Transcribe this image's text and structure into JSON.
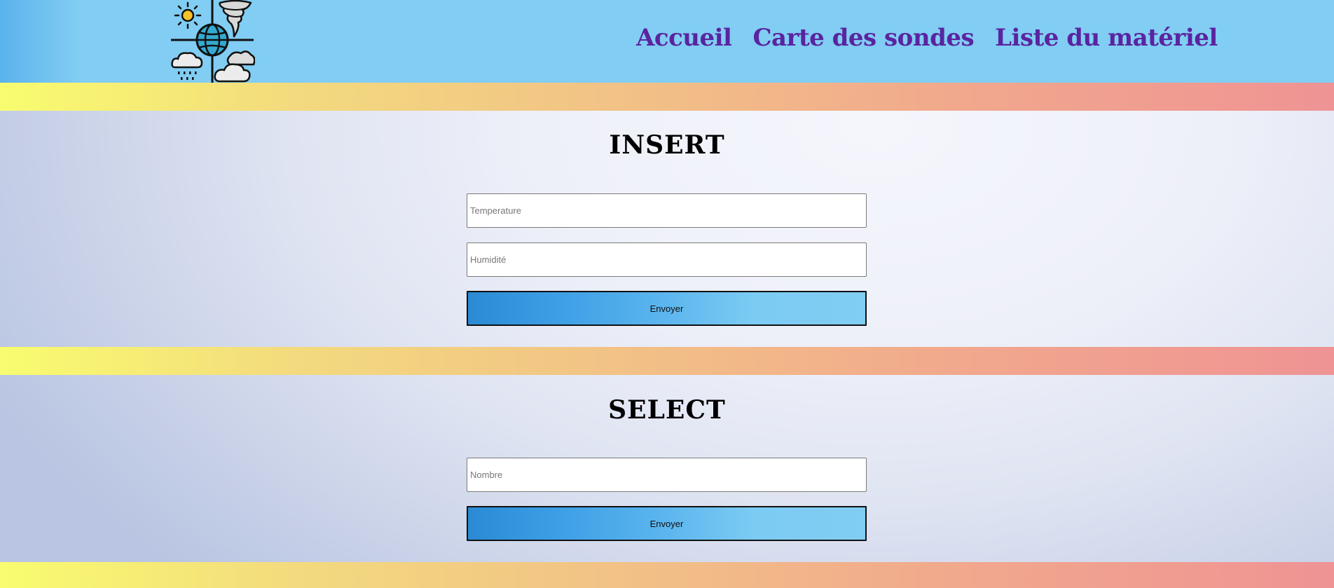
{
  "header": {
    "logo_icon": "weather-logo-icon",
    "nav": [
      {
        "label": "Accueil"
      },
      {
        "label": "Carte des sondes"
      },
      {
        "label": "Liste du matériel"
      }
    ],
    "nav_color": "#5a24a0",
    "background": "#81cdf3"
  },
  "insert": {
    "title": "INSERT",
    "temperature_placeholder": "Temperature",
    "humidity_placeholder": "Humidité",
    "submit_label": "Envoyer"
  },
  "select": {
    "title": "SELECT",
    "number_placeholder": "Nombre",
    "submit_label": "Envoyer"
  }
}
